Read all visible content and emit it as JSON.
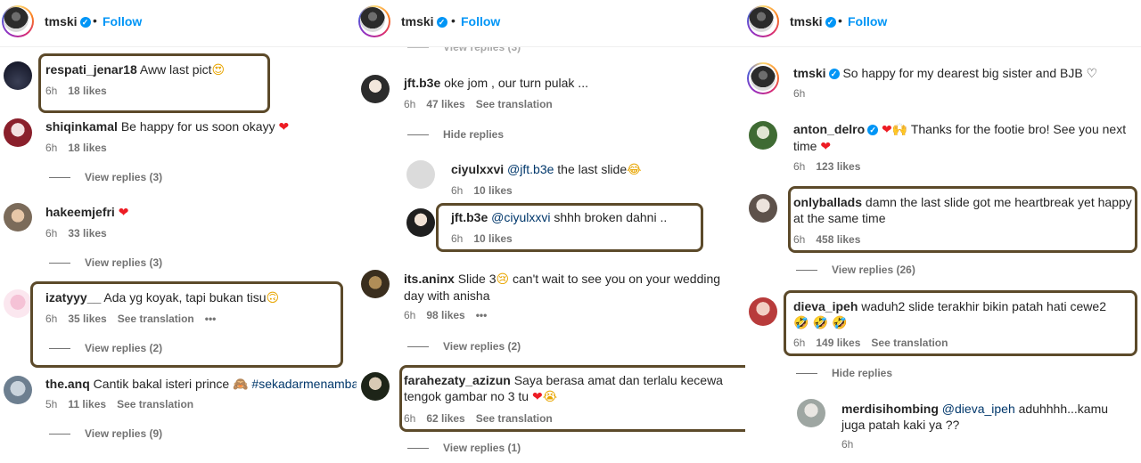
{
  "header": {
    "username": "tmski",
    "verified_glyph": "✓",
    "separator": "•",
    "follow_label": "Follow"
  },
  "panel1": {
    "c1": {
      "user": "respati_jenar18",
      "text": "Aww last pict",
      "emoji": "😍",
      "time": "6h",
      "likes": "18 likes"
    },
    "c2": {
      "user": "shiqinkamal",
      "text": "Be happy for us soon okayy",
      "emoji": "❤",
      "time": "6h",
      "likes": "18 likes",
      "replies": "View replies (3)"
    },
    "c3": {
      "user": "hakeemjefri",
      "emoji": "❤",
      "time": "6h",
      "likes": "33 likes",
      "replies": "View replies (3)"
    },
    "c4": {
      "user": "izatyyy__",
      "text": "Ada yg koyak, tapi bukan tisu",
      "emoji": "🙃",
      "time": "6h",
      "likes": "35 likes",
      "translate": "See translation",
      "more": "•••",
      "replies": "View replies (2)"
    },
    "c5": {
      "user": "the.anq",
      "text": "Cantik bakal isteri prince",
      "emoji": "🙈",
      "hashtag": "#sekadarmenambah",
      "time": "5h",
      "likes": "11 likes",
      "translate": "See translation",
      "replies": "View replies (9)"
    }
  },
  "panel2": {
    "top_replies": "View replies (3)",
    "c1": {
      "user": "jft.b3e",
      "text": "oke jom , our turn pulak ...",
      "time": "6h",
      "likes": "47 likes",
      "translate": "See translation",
      "hide": "Hide replies"
    },
    "r1": {
      "user": "ciyulxxvi",
      "mention": "@jft.b3e",
      "text": "the last slide",
      "emoji": "😂",
      "time": "6h",
      "likes": "10 likes"
    },
    "r2": {
      "user": "jft.b3e",
      "mention": "@ciyulxxvi",
      "text": "shhh broken dahni ..",
      "time": "6h",
      "likes": "10 likes"
    },
    "c2": {
      "user": "its.aninx",
      "text_a": "Slide 3",
      "emoji": "😢",
      "text_b": "can't wait to see you on your wedding day with anisha",
      "time": "6h",
      "likes": "98 likes",
      "more": "•••",
      "replies": "View replies (2)"
    },
    "c3": {
      "user": "farahezaty_azizun",
      "text": "Saya berasa amat dan terlalu kecewa tengok gambar no 3 tu",
      "emoji": "❤",
      "emoji2": "😭",
      "time": "6h",
      "likes": "62 likes",
      "translate": "See translation",
      "replies": "View replies (1)"
    }
  },
  "panel3": {
    "c0": {
      "user": "tmski",
      "text": "So happy for my dearest big sister and BJB",
      "emoji": "♡",
      "time": "6h"
    },
    "c1": {
      "user": "anton_delro",
      "emoji": "❤",
      "emoji2": "🙌",
      "text": "Thanks for the footie bro! See you next time",
      "emoji3": "❤",
      "time": "6h",
      "likes": "123 likes"
    },
    "c2": {
      "user": "onlyballads",
      "text": "damn the last slide got me heartbreak yet happy at the same time",
      "time": "6h",
      "likes": "458 likes",
      "replies": "View replies (26)"
    },
    "c3": {
      "user": "dieva_ipeh",
      "text": "waduh2 slide terakhir bikin patah hati cewe2",
      "emoji": "🤣 🤣",
      "emoji2": "🤣",
      "time": "6h",
      "likes": "149 likes",
      "translate": "See translation",
      "hide": "Hide replies"
    },
    "r1": {
      "user": "merdisihombing",
      "mention": "@dieva_ipeh",
      "text": "aduhhhh...kamu juga patah kaki ya ??",
      "time": "6h"
    }
  },
  "colors": {
    "link": "#0095f6",
    "mention": "#00376b",
    "meta": "#737373",
    "highlight": "#5c4a2a"
  }
}
